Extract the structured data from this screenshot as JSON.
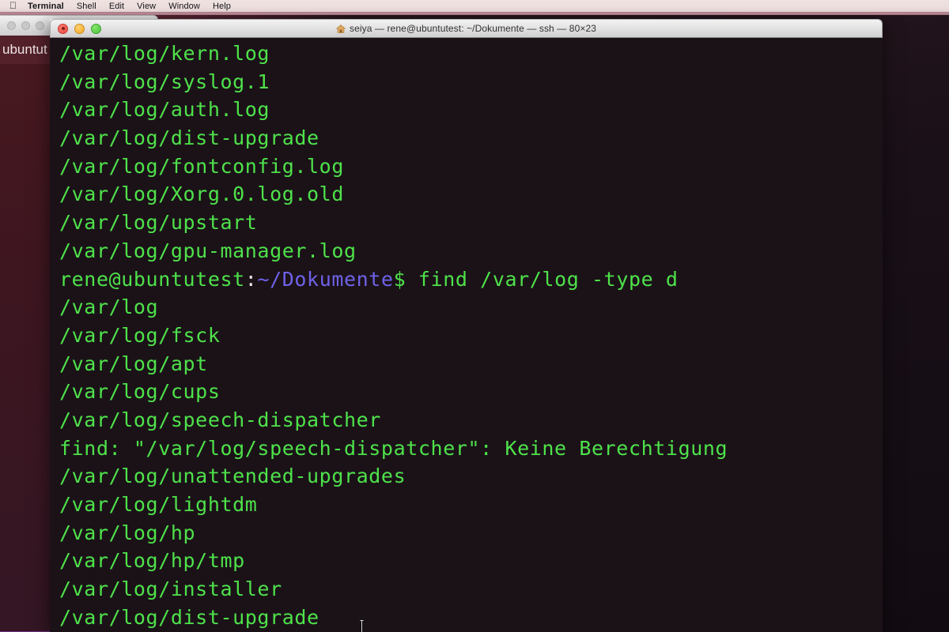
{
  "menubar": {
    "apple_icon": "apple-logo",
    "items": [
      {
        "label": "Terminal",
        "bold": true
      },
      {
        "label": "Shell",
        "bold": false
      },
      {
        "label": "Edit",
        "bold": false
      },
      {
        "label": "View",
        "bold": false
      },
      {
        "label": "Window",
        "bold": false
      },
      {
        "label": "Help",
        "bold": false
      }
    ]
  },
  "background_window": {
    "tab_label": "ubuntut"
  },
  "terminal": {
    "title": "seiya — rene@ubuntutest: ~/Dokumente — ssh — 80×23",
    "title_icon": "home-icon",
    "traffic_lights": {
      "close_label": "close",
      "minimize_label": "minimize",
      "zoom_label": "zoom"
    },
    "geometry": "80×23",
    "host": "seiya",
    "session": "rene@ubuntutest: ~/Dokumente",
    "protocol": "ssh",
    "colors": {
      "background": "#1b1218",
      "foreground_green": "#4ee24a",
      "path_blue": "#6f62e8",
      "text_white": "#e6e6e6"
    },
    "lines": [
      {
        "type": "out",
        "text": "/var/log/kern.log"
      },
      {
        "type": "out",
        "text": "/var/log/syslog.1"
      },
      {
        "type": "out",
        "text": "/var/log/auth.log"
      },
      {
        "type": "out",
        "text": "/var/log/dist-upgrade"
      },
      {
        "type": "out",
        "text": "/var/log/fontconfig.log"
      },
      {
        "type": "out",
        "text": "/var/log/Xorg.0.log.old"
      },
      {
        "type": "out",
        "text": "/var/log/upstart"
      },
      {
        "type": "out",
        "text": "/var/log/gpu-manager.log"
      },
      {
        "type": "prompt",
        "user_host": "rene@ubuntutest",
        "colon": ":",
        "path": "~/Dokumente",
        "command": "$ find /var/log -type d"
      },
      {
        "type": "out",
        "text": "/var/log"
      },
      {
        "type": "out",
        "text": "/var/log/fsck"
      },
      {
        "type": "out",
        "text": "/var/log/apt"
      },
      {
        "type": "out",
        "text": "/var/log/cups"
      },
      {
        "type": "out",
        "text": "/var/log/speech-dispatcher"
      },
      {
        "type": "out",
        "text": "find: \"/var/log/speech-dispatcher\": Keine Berechtigung"
      },
      {
        "type": "out",
        "text": "/var/log/unattended-upgrades"
      },
      {
        "type": "out",
        "text": "/var/log/lightdm"
      },
      {
        "type": "out",
        "text": "/var/log/hp"
      },
      {
        "type": "out",
        "text": "/var/log/hp/tmp"
      },
      {
        "type": "out",
        "text": "/var/log/installer"
      },
      {
        "type": "out",
        "text": "/var/log/dist-upgrade"
      }
    ]
  },
  "cursor": {
    "type": "i-beam-cursor"
  }
}
